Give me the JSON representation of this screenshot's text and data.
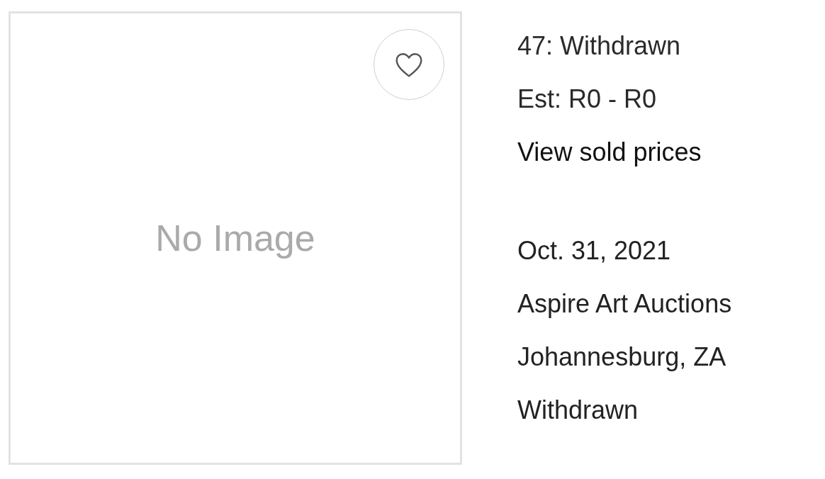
{
  "lot": {
    "image_placeholder": "No Image",
    "favorited": false
  },
  "details": [
    {
      "kind": "text",
      "text": "47: Withdrawn"
    },
    {
      "kind": "text",
      "text": "Est: R0 - R0"
    },
    {
      "kind": "link",
      "text": "View sold prices"
    }
  ],
  "sale": [
    "Oct. 31, 2021",
    "Aspire Art Auctions",
    "Johannesburg, ZA",
    "Withdrawn"
  ]
}
